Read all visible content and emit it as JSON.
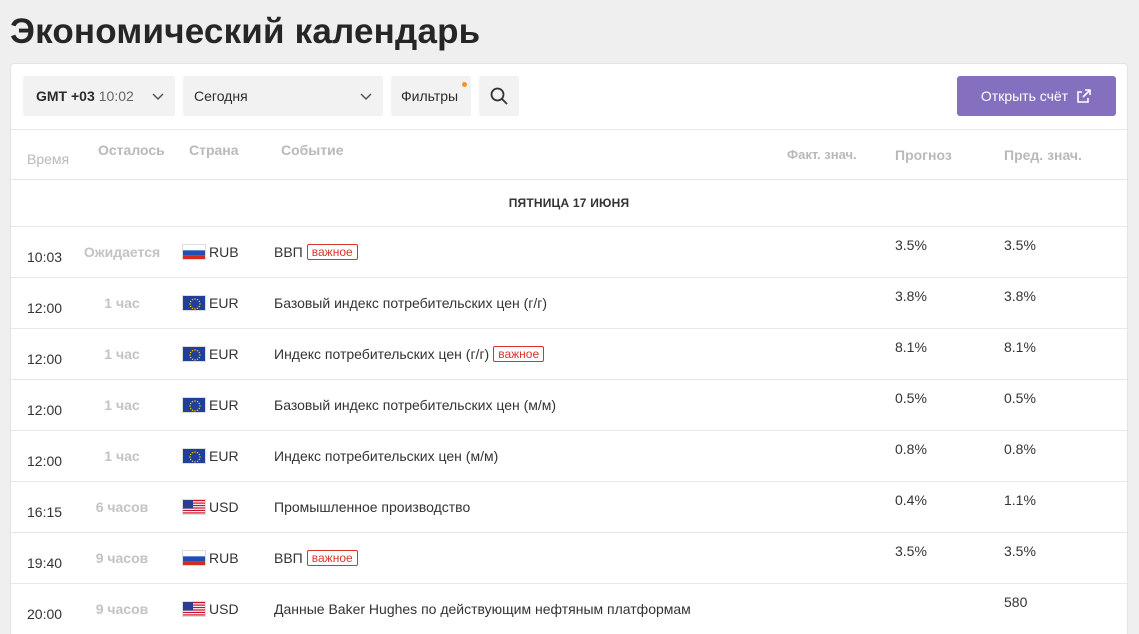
{
  "title": "Экономический календарь",
  "toolbar": {
    "tz_label": "GMT +03",
    "tz_time": "10:02",
    "date_value": "Сегодня",
    "filters_label": "Фильтры",
    "open_account_label": "Открыть счёт"
  },
  "columns": {
    "time": "Время",
    "left": "Осталось",
    "country": "Страна",
    "event": "Событие",
    "actual": "Факт. знач.",
    "forecast": "Прогноз",
    "previous": "Пред. знач."
  },
  "day_header": "ПЯТНИЦА 17 ИЮНЯ",
  "badge_label": "важное",
  "rows": [
    {
      "time": "10:03",
      "left": "Ожидается",
      "flag": "ru",
      "currency": "RUB",
      "event": "ВВП",
      "important": true,
      "forecast": "3.5%",
      "previous": "3.5%"
    },
    {
      "time": "12:00",
      "left": "1 час",
      "flag": "eu",
      "currency": "EUR",
      "event": "Базовый индекс потребительских цен (г/г)",
      "important": false,
      "forecast": "3.8%",
      "previous": "3.8%"
    },
    {
      "time": "12:00",
      "left": "1 час",
      "flag": "eu",
      "currency": "EUR",
      "event": "Индекс потребительских цен (г/г)",
      "important": true,
      "forecast": "8.1%",
      "previous": "8.1%"
    },
    {
      "time": "12:00",
      "left": "1 час",
      "flag": "eu",
      "currency": "EUR",
      "event": "Базовый индекс потребительских цен (м/м)",
      "important": false,
      "forecast": "0.5%",
      "previous": "0.5%"
    },
    {
      "time": "12:00",
      "left": "1 час",
      "flag": "eu",
      "currency": "EUR",
      "event": "Индекс потребительских цен (м/м)",
      "important": false,
      "forecast": "0.8%",
      "previous": "0.8%"
    },
    {
      "time": "16:15",
      "left": "6 часов",
      "flag": "us",
      "currency": "USD",
      "event": "Промышленное производство",
      "important": false,
      "forecast": "0.4%",
      "previous": "1.1%"
    },
    {
      "time": "19:40",
      "left": "9 часов",
      "flag": "ru",
      "currency": "RUB",
      "event": "ВВП",
      "important": true,
      "forecast": "3.5%",
      "previous": "3.5%"
    },
    {
      "time": "20:00",
      "left": "9 часов",
      "flag": "us",
      "currency": "USD",
      "event": "Данные Baker Hughes по действующим нефтяным платформам",
      "important": false,
      "forecast": "",
      "previous": "580"
    }
  ]
}
